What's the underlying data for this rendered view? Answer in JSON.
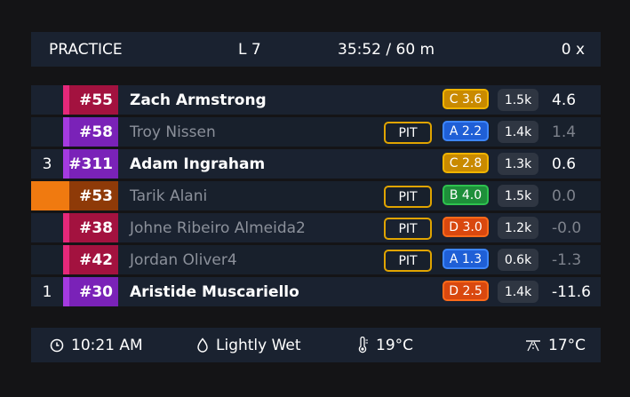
{
  "header": {
    "session": "PRACTICE",
    "lap": "L 7",
    "time": "35:52 / 60 m",
    "incidents": "0 x"
  },
  "rows": [
    {
      "pos": "",
      "number": "#55",
      "name": "Zach Armstrong",
      "pit": "",
      "license": "C 3.6",
      "irating": "1.5k",
      "gap": "4.6",
      "dim": false,
      "stripe_color": "#e6287a",
      "number_bg": "#a3123f",
      "license_color": "#c98a00",
      "license_border": "#f0b400",
      "pos_bg": ""
    },
    {
      "pos": "",
      "number": "#58",
      "name": "Troy Nissen",
      "pit": "PIT",
      "license": "A 2.2",
      "irating": "1.4k",
      "gap": "1.4",
      "dim": true,
      "stripe_color": "#a53ae0",
      "number_bg": "#7a22b8",
      "license_color": "#1f5fd6",
      "license_border": "#3d86ff",
      "pos_bg": ""
    },
    {
      "pos": "3",
      "number": "#311",
      "name": "Adam Ingraham",
      "pit": "",
      "license": "C 2.8",
      "irating": "1.3k",
      "gap": "0.6",
      "dim": false,
      "stripe_color": "#a53ae0",
      "number_bg": "#7a22b8",
      "license_color": "#c98a00",
      "license_border": "#f0b400",
      "pos_bg": ""
    },
    {
      "pos": "",
      "number": "#53",
      "name": "Tarik Alani",
      "pit": "PIT",
      "license": "B 4.0",
      "irating": "1.5k",
      "gap": "0.0",
      "dim": true,
      "stripe_color": "#f07a10",
      "number_bg": "#8e3a08",
      "license_color": "#1e8f3a",
      "license_border": "#2ec24f",
      "pos_bg": "#f07a10"
    },
    {
      "pos": "",
      "number": "#38",
      "name": "Johne Ribeiro Almeida2",
      "pit": "PIT",
      "license": "D 3.0",
      "irating": "1.2k",
      "gap": "-0.0",
      "dim": true,
      "stripe_color": "#e6287a",
      "number_bg": "#a3123f",
      "license_color": "#d9480f",
      "license_border": "#ff6a1a",
      "pos_bg": ""
    },
    {
      "pos": "",
      "number": "#42",
      "name": "Jordan Oliver4",
      "pit": "PIT",
      "license": "A 1.3",
      "irating": "0.6k",
      "gap": "-1.3",
      "dim": true,
      "stripe_color": "#e6287a",
      "number_bg": "#a3123f",
      "license_color": "#1f5fd6",
      "license_border": "#3d86ff",
      "pos_bg": ""
    },
    {
      "pos": "1",
      "number": "#30",
      "name": "Aristide Muscariello",
      "pit": "",
      "license": "D 2.5",
      "irating": "1.4k",
      "gap": "-11.6",
      "dim": false,
      "stripe_color": "#a53ae0",
      "number_bg": "#7a22b8",
      "license_color": "#d9480f",
      "license_border": "#ff6a1a",
      "pos_bg": ""
    }
  ],
  "footer": {
    "clock": "10:21 AM",
    "clock_icon": "clock-icon",
    "track_state": "Lightly Wet",
    "track_state_icon": "water-drop-icon",
    "air_temp": "19°C",
    "air_temp_icon": "thermometer-icon",
    "track_temp": "17°C",
    "track_temp_icon": "track-temperature-icon"
  }
}
